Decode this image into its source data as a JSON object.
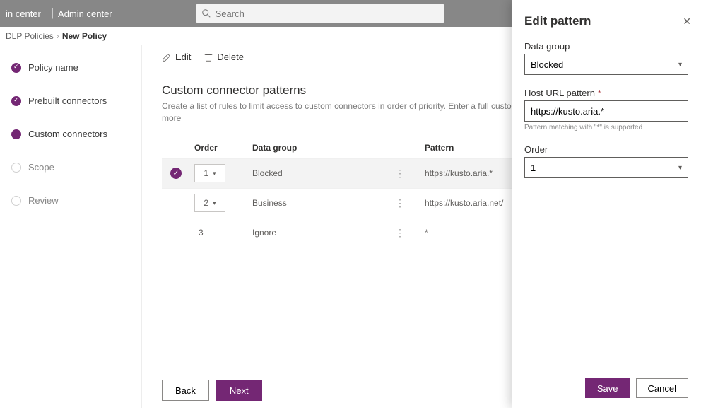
{
  "top": {
    "app_left": "in center",
    "app_right": "Admin center",
    "search_placeholder": "Search"
  },
  "crumbs": {
    "a": "DLP Policies",
    "b": "New Policy"
  },
  "steps": [
    {
      "label": "Policy name",
      "state": "done"
    },
    {
      "label": "Prebuilt connectors",
      "state": "done"
    },
    {
      "label": "Custom connectors",
      "state": "cur"
    },
    {
      "label": "Scope",
      "state": "pend"
    },
    {
      "label": "Review",
      "state": "pend"
    }
  ],
  "toolbar": {
    "edit": "Edit",
    "del": "Delete"
  },
  "page": {
    "title": "Custom connector patterns",
    "desc": "Create a list of rules to limit access to custom connectors in order of priority. Enter a full custom connector U",
    "more": "more"
  },
  "columns": {
    "order": "Order",
    "group": "Data group",
    "pattern": "Pattern"
  },
  "rows": [
    {
      "order": "1",
      "group": "Blocked",
      "pattern": "https://kusto.aria.*",
      "selected": true,
      "dropdown": true
    },
    {
      "order": "2",
      "group": "Business",
      "pattern": "https://kusto.aria.net/",
      "selected": false,
      "dropdown": true
    },
    {
      "order": "3",
      "group": "Ignore",
      "pattern": "*",
      "selected": false,
      "dropdown": false
    }
  ],
  "footer": {
    "back": "Back",
    "next": "Next"
  },
  "panel": {
    "title": "Edit pattern",
    "fields": {
      "group_label": "Data group",
      "group_value": "Blocked",
      "host_label": "Host URL pattern",
      "host_value": "https://kusto.aria.*",
      "host_hint": "Pattern matching with \"*\" is supported",
      "order_label": "Order",
      "order_value": "1"
    },
    "save": "Save",
    "cancel": "Cancel"
  }
}
